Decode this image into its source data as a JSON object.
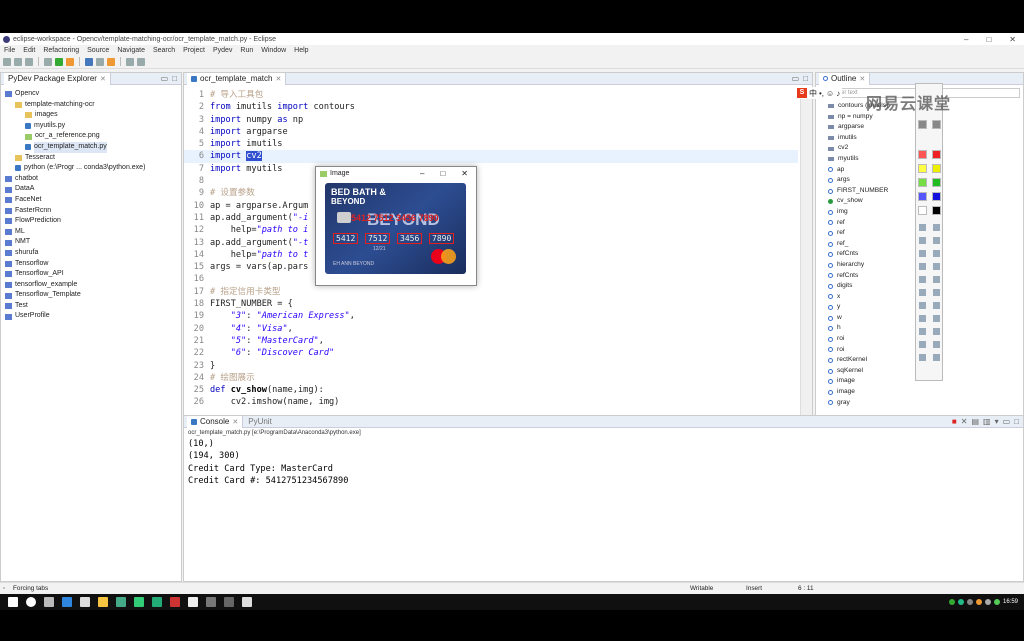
{
  "window": {
    "title": "eclipse-workspace - Opencv/template-matching-ocr/ocr_template_match.py - Eclipse"
  },
  "menu": [
    "File",
    "Edit",
    "Refactoring",
    "Source",
    "Navigate",
    "Search",
    "Project",
    "Pydev",
    "Run",
    "Window",
    "Help"
  ],
  "package_explorer": {
    "title": "PyDev Package Explorer",
    "items": [
      {
        "label": "Opencv",
        "icon": "project-icon",
        "depth": 0
      },
      {
        "label": "template-matching-ocr",
        "icon": "folder-icon",
        "depth": 1
      },
      {
        "label": "images",
        "icon": "folder-icon",
        "depth": 2
      },
      {
        "label": "myutils.py",
        "icon": "python-file-icon",
        "depth": 2
      },
      {
        "label": "ocr_a_reference.png",
        "icon": "image-file-icon",
        "depth": 2
      },
      {
        "label": "ocr_template_match.py",
        "icon": "python-file-icon",
        "depth": 2
      },
      {
        "label": "Tesseract",
        "icon": "folder-icon",
        "depth": 1
      },
      {
        "label": "python  (e:\\Progr ... conda3\\python.exe)",
        "icon": "python-interpreter-icon",
        "depth": 1
      },
      {
        "label": "chatbot",
        "icon": "project-icon",
        "depth": 0
      },
      {
        "label": "DataA",
        "icon": "project-icon",
        "depth": 0
      },
      {
        "label": "FaceNet",
        "icon": "project-icon",
        "depth": 0
      },
      {
        "label": "FasterRcnn",
        "icon": "project-icon",
        "depth": 0
      },
      {
        "label": "FlowPrediction",
        "icon": "project-icon",
        "depth": 0
      },
      {
        "label": "ML",
        "icon": "project-icon",
        "depth": 0
      },
      {
        "label": "NMT",
        "icon": "project-icon",
        "depth": 0
      },
      {
        "label": "shurufa",
        "icon": "project-icon",
        "depth": 0
      },
      {
        "label": "Tensorflow",
        "icon": "project-icon",
        "depth": 0
      },
      {
        "label": "Tensorflow_API",
        "icon": "project-icon",
        "depth": 0
      },
      {
        "label": "tensorflow_example",
        "icon": "project-icon",
        "depth": 0
      },
      {
        "label": "Tensorflow_Template",
        "icon": "project-icon",
        "depth": 0
      },
      {
        "label": "Test",
        "icon": "project-icon",
        "depth": 0
      },
      {
        "label": "UserProfile",
        "icon": "project-icon",
        "depth": 0
      }
    ]
  },
  "editor": {
    "tab": "ocr_template_match",
    "lines": [
      {
        "n": "1",
        "html": "<span class='cm'># 导入工具包</span>"
      },
      {
        "n": "2",
        "html": "<span class='kw'>from</span> imutils <span class='kw'>import</span> contours"
      },
      {
        "n": "3",
        "html": "<span class='kw'>import</span> numpy <span class='kw'>as</span> np"
      },
      {
        "n": "4",
        "html": "<span class='kw'>import</span> argparse"
      },
      {
        "n": "5",
        "html": "<span class='kw'>import</span> imutils"
      },
      {
        "n": "6",
        "html": "<span class='kw'>import</span> <span class='hl'>cv2</span>",
        "current": true
      },
      {
        "n": "7",
        "html": "<span class='kw'>import</span> myutils"
      },
      {
        "n": "8",
        "html": ""
      },
      {
        "n": "9",
        "html": "<span class='cm'># 设置参数</span>"
      },
      {
        "n": "10",
        "html": "ap = argparse.Argum"
      },
      {
        "n": "11",
        "html": "ap.add_argument(<span class='st'>\"-i</span>"
      },
      {
        "n": "12",
        "html": "    help=<span class='st'>\"path to i</span>"
      },
      {
        "n": "13",
        "html": "ap.add_argument(<span class='st'>\"-t</span>                        ,"
      },
      {
        "n": "14",
        "html": "    help=<span class='st'>\"path to t</span>"
      },
      {
        "n": "15",
        "html": "args = vars(ap.pars"
      },
      {
        "n": "16",
        "html": ""
      },
      {
        "n": "17",
        "html": "<span class='cm'># 指定信用卡类型</span>"
      },
      {
        "n": "18",
        "html": "FIRST_NUMBER = {"
      },
      {
        "n": "19",
        "html": "    <span class='st'>\"3\"</span>: <span class='st'>\"American Express\"</span>,"
      },
      {
        "n": "20",
        "html": "    <span class='st'>\"4\"</span>: <span class='st'>\"Visa\"</span>,"
      },
      {
        "n": "21",
        "html": "    <span class='st'>\"5\"</span>: <span class='st'>\"MasterCard\"</span>,"
      },
      {
        "n": "22",
        "html": "    <span class='st'>\"6\"</span>: <span class='st'>\"Discover Card\"</span>"
      },
      {
        "n": "23",
        "html": "}"
      },
      {
        "n": "24",
        "html": "<span class='cm'># 绘图展示</span>"
      },
      {
        "n": "25",
        "html": "<span class='kw'>def</span> <span class='fn'>cv_show</span>(name,img):"
      },
      {
        "n": "26",
        "html": "    cv2.imshow(name, img)"
      }
    ]
  },
  "image_window": {
    "title": "Image",
    "card": {
      "brand_line1": "BED BATH &",
      "brand_line2": "BEYOND",
      "brand_large": "BEYOND",
      "top_number": "5412 7512 3456 7890",
      "groups": [
        "5412",
        "7512",
        "3456",
        "7890"
      ],
      "expiry": "12/21",
      "holder": "EH ANN BEYOND",
      "network": "MasterCard"
    }
  },
  "outline": {
    "title": "Outline",
    "filter_placeholder": "type filter text",
    "items": [
      {
        "label": "contours (imutils)",
        "kind": "import"
      },
      {
        "label": "np = numpy",
        "kind": "import"
      },
      {
        "label": "argparse",
        "kind": "import"
      },
      {
        "label": "imutils",
        "kind": "import"
      },
      {
        "label": "cv2",
        "kind": "import"
      },
      {
        "label": "myutils",
        "kind": "import"
      },
      {
        "label": "ap",
        "kind": "var"
      },
      {
        "label": "args",
        "kind": "var"
      },
      {
        "label": "FIRST_NUMBER",
        "kind": "var"
      },
      {
        "label": "cv_show",
        "kind": "func"
      },
      {
        "label": "img",
        "kind": "var"
      },
      {
        "label": "ref",
        "kind": "var"
      },
      {
        "label": "ref",
        "kind": "var"
      },
      {
        "label": "ref_",
        "kind": "var"
      },
      {
        "label": "refCnts",
        "kind": "var"
      },
      {
        "label": "hierarchy",
        "kind": "var"
      },
      {
        "label": "refCnts",
        "kind": "var"
      },
      {
        "label": "digits",
        "kind": "var"
      },
      {
        "label": "x",
        "kind": "var"
      },
      {
        "label": "y",
        "kind": "var"
      },
      {
        "label": "w",
        "kind": "var"
      },
      {
        "label": "h",
        "kind": "var"
      },
      {
        "label": "roi",
        "kind": "var"
      },
      {
        "label": "roi",
        "kind": "var"
      },
      {
        "label": "rectKernel",
        "kind": "var"
      },
      {
        "label": "sqKernel",
        "kind": "var"
      },
      {
        "label": "image",
        "kind": "var"
      },
      {
        "label": "image",
        "kind": "var"
      },
      {
        "label": "gray",
        "kind": "var"
      }
    ]
  },
  "console": {
    "tab": "Console",
    "tab2": "PyUnit",
    "path": "ocr_template_match.py [e:\\ProgramData\\Anaconda3\\python.exe]",
    "output": "(10,)\n(194, 300)\nCredit Card Type: MasterCard\nCredit Card #: 5412751234567890"
  },
  "status": {
    "left": "Forcing tabs",
    "mode": "Writable",
    "insert": "Insert",
    "position": "6 : 11"
  },
  "watermark": "网易云课堂",
  "clock": "16:59",
  "colors": {
    "keyword": "#0000c0",
    "string": "#2a00ff",
    "comment": "#b9a28a",
    "selection": "#3050d0",
    "card_bg": "#2d4d92",
    "ocr_box": "#e02020"
  }
}
